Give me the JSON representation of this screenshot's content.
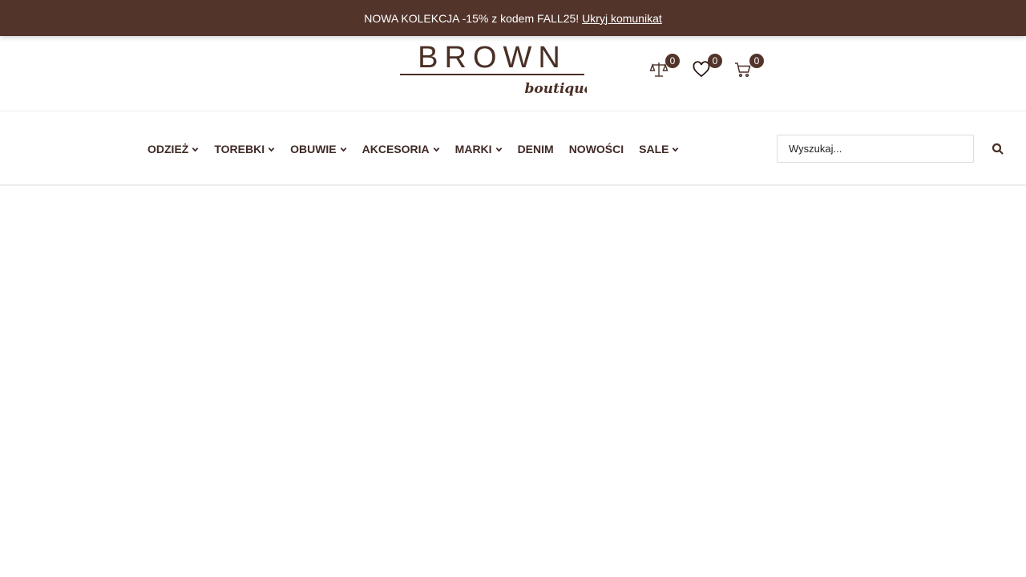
{
  "announcement": {
    "text": "NOWA KOLEKCJA -15% z kodem FALL25!",
    "hide_link": "Ukryj komunikat"
  },
  "brand": {
    "name": "BROWN",
    "tagline": "boutique",
    "color": "#52342b"
  },
  "header_icons": {
    "compare": {
      "icon": "scales-icon",
      "count": "0"
    },
    "wishlist": {
      "icon": "heart-icon",
      "count": "0"
    },
    "cart": {
      "icon": "cart-icon",
      "count": "0"
    }
  },
  "nav": {
    "items": [
      {
        "label": "ODZIEŻ",
        "has_dropdown": true
      },
      {
        "label": "TOREBKI",
        "has_dropdown": true
      },
      {
        "label": "OBUWIE",
        "has_dropdown": true
      },
      {
        "label": "AKCESORIA",
        "has_dropdown": true
      },
      {
        "label": "MARKI",
        "has_dropdown": true
      },
      {
        "label": "DENIM",
        "has_dropdown": false
      },
      {
        "label": "NOWOŚCI",
        "has_dropdown": false
      },
      {
        "label": "SALE",
        "has_dropdown": true
      }
    ]
  },
  "search": {
    "placeholder": "Wyszukaj...",
    "value": ""
  }
}
